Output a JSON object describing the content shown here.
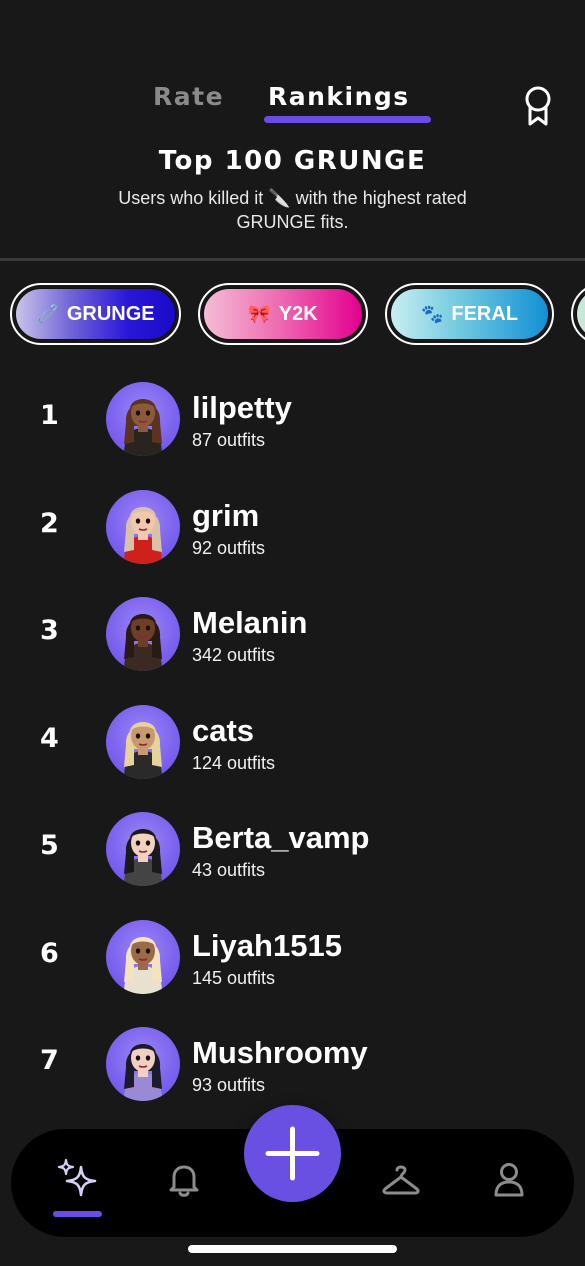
{
  "header": {
    "tabs": [
      {
        "label": "Rate",
        "active": false
      },
      {
        "label": "Rankings",
        "active": true
      }
    ],
    "award_icon": "award-ribbon-icon"
  },
  "hero": {
    "title": "Top 100 GRUNGE",
    "subtitle": "Users who killed it 🔪 with the highest rated GRUNGE fits."
  },
  "categories": [
    {
      "emoji": "🧷",
      "label": "GRUNGE",
      "selected": true
    },
    {
      "emoji": "🎀",
      "label": "Y2K",
      "selected": false
    },
    {
      "emoji": "🐾",
      "label": "FERAL",
      "selected": false
    },
    {
      "emoji": "",
      "label": "",
      "selected": false
    }
  ],
  "rankings": [
    {
      "rank": "1",
      "username": "lilpetty",
      "outfits": "87 outfits",
      "skin": "#8a5a3b",
      "hair": "#5a3420",
      "top": "#2a2420"
    },
    {
      "rank": "2",
      "username": "grim",
      "outfits": "92 outfits",
      "skin": "#f1c7ae",
      "hair": "#d9c2a8",
      "top": "#d0201c"
    },
    {
      "rank": "3",
      "username": "Melanin",
      "outfits": "342 outfits",
      "skin": "#6e3f28",
      "hair": "#2a1a14",
      "top": "#3a2a22"
    },
    {
      "rank": "4",
      "username": "cats",
      "outfits": "124 outfits",
      "skin": "#c99a72",
      "hair": "#e6d29a",
      "top": "#2a2a2a"
    },
    {
      "rank": "5",
      "username": "Berta_vamp",
      "outfits": "43 outfits",
      "skin": "#f0d2c0",
      "hair": "#1a1a1a",
      "top": "#444"
    },
    {
      "rank": "6",
      "username": "Liyah1515",
      "outfits": "145 outfits",
      "skin": "#9b6a48",
      "hair": "#f3e3c0",
      "top": "#e9e1cf"
    },
    {
      "rank": "7",
      "username": "Mushroomy",
      "outfits": "93 outfits",
      "skin": "#f0d0c2",
      "hair": "#1b1b2a",
      "top": "#9a8ad6"
    }
  ],
  "bottom_nav": {
    "items": [
      "sparkles-icon",
      "bell-icon",
      "plus-icon",
      "hanger-icon",
      "profile-icon"
    ],
    "active": "sparkles-icon"
  },
  "colors": {
    "accent": "#6b4de6",
    "background": "#181818",
    "nav_background": "#000000"
  }
}
